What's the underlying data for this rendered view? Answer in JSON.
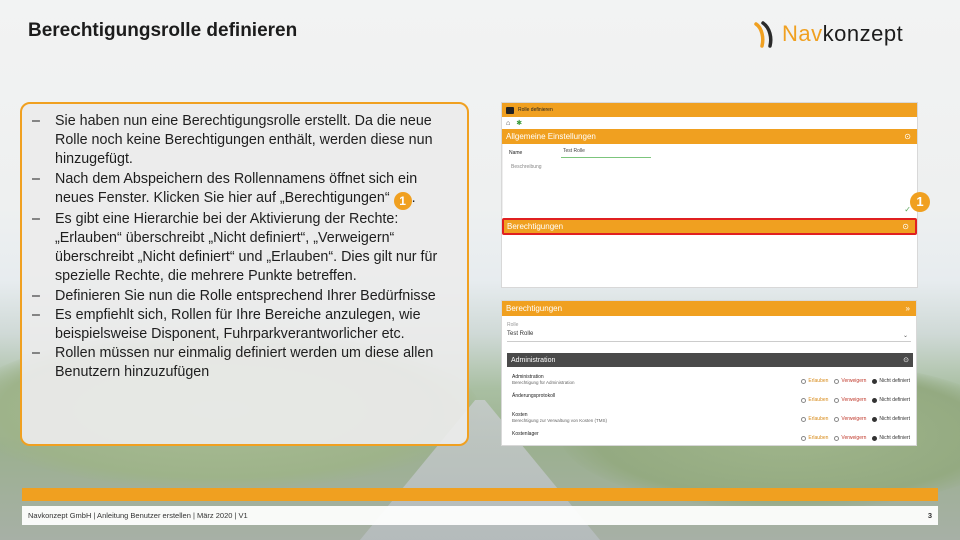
{
  "title": "Berechtigungsrolle definieren",
  "logo": {
    "part1": "Nav",
    "part2": "konzept"
  },
  "bullets": [
    {
      "text": "Sie haben nun eine Berechtigungsrolle erstellt. Da die neue Rolle noch keine Berechtigungen enthält, werden diese nun hinzugefügt."
    },
    {
      "text_before": "Nach dem Abspeichern des Rollennamens öffnet sich ein neues Fenster. Klicken Sie hier auf „Berechtigungen“",
      "badge": "1",
      "text_after": "."
    },
    {
      "text": "Es gibt eine Hierarchie bei der Aktivierung der Rechte: „Erlauben“ überschreibt „Nicht definiert“, „Verweigern“ überschreibt „Nicht definiert“ und „Erlauben“. Dies gilt nur für spezielle Rechte, die mehrere Punkte betreffen."
    },
    {
      "text": "Definieren Sie nun die Rolle entsprechend Ihrer Bedürfnisse"
    },
    {
      "text": "Es empfiehlt sich, Rollen für Ihre Bereiche anzulegen, wie beispielsweise Disponent, Fuhrparkverantworlicher etc."
    },
    {
      "text": "Rollen müssen nur einmalig definiert werden um diese allen Benutzern hinzuzufügen"
    }
  ],
  "bullet_marker": "–",
  "screenshot1": {
    "top_title": "Rolle definieren",
    "section_general": "Allgemeine Einstellungen",
    "name_label": "Name",
    "name_value": "Test Rolle",
    "desc_label": "Beschreibung",
    "section_permissions": "Berechtigungen",
    "badge": "1"
  },
  "screenshot2": {
    "header": "Berechtigungen",
    "role_label": "Rolle",
    "role_value": "Test Rolle",
    "group": "Administration",
    "rows": [
      {
        "name": "Administration",
        "desc": "Berechtigung für Administration",
        "selected": "undef"
      },
      {
        "name": "Änderungsprotokoll",
        "desc": "",
        "selected": "undef"
      },
      {
        "name": "Kosten",
        "desc": "Berechtigung zur Verwaltung von Kosten (TMS)",
        "selected": "undef"
      },
      {
        "name": "Kostenlager",
        "desc": "",
        "selected": "undef"
      }
    ],
    "options": {
      "allow": "Erlauben",
      "deny": "Verweigern",
      "undef": "Nicht definiert"
    }
  },
  "footer": {
    "left": "Navkonzept GmbH  |  Anleitung Benutzer erstellen  |  März 2020  |  V1",
    "page": "3"
  },
  "colors": {
    "accent": "#f0a020",
    "highlight": "#e02020",
    "admin_bar": "#4a4a4a"
  }
}
